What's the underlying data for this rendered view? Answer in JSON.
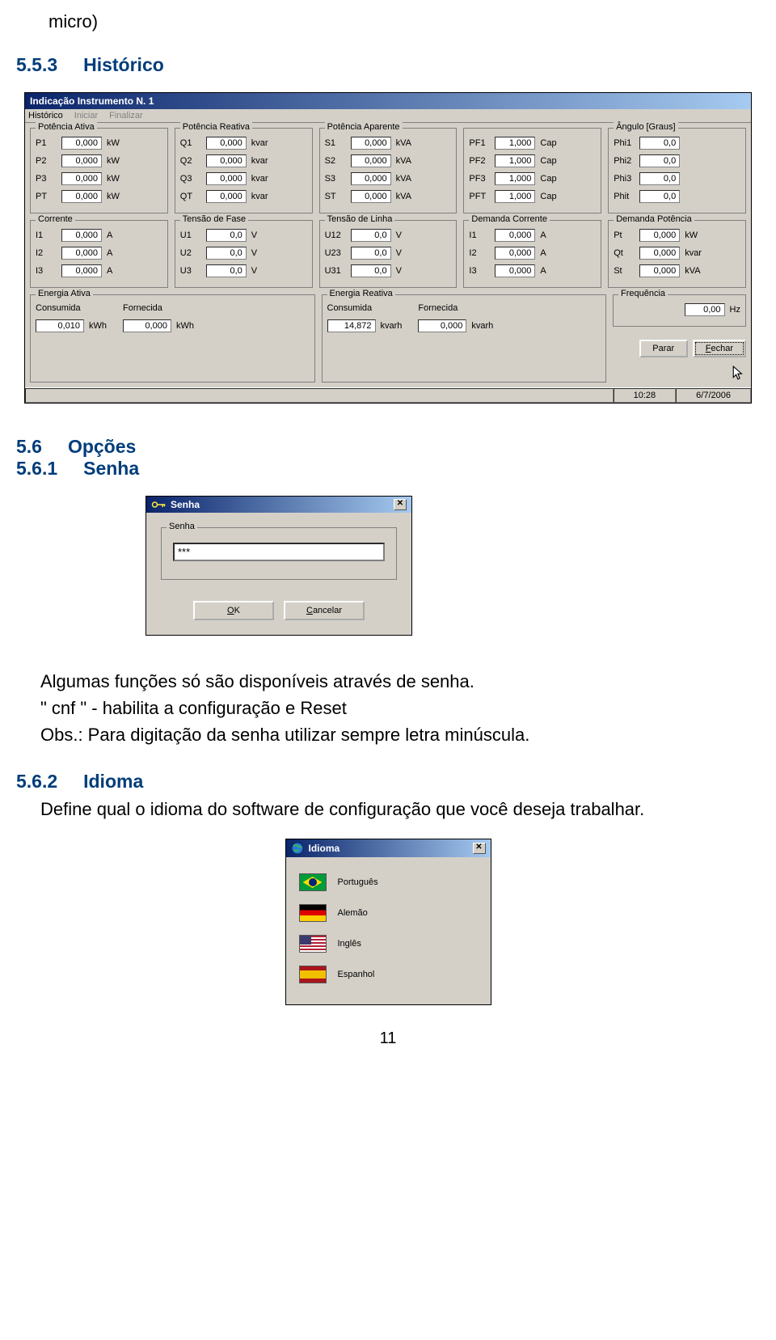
{
  "doc": {
    "micro_line": "micro)",
    "h1_num": "5.5.3",
    "h1_text": "Histórico",
    "h2_num": "5.6",
    "h2_text": "Opções",
    "h3_num": "5.6.1",
    "h3_text": "Senha",
    "para1": "Algumas funções só são disponíveis através de senha.",
    "para2": "\" cnf \" - habilita a configuração  e Reset",
    "para3": "Obs.: Para digitação da senha utilizar sempre letra minúscula.",
    "h4_num": "5.6.2",
    "h4_text": "Idioma",
    "para4": "Define qual o idioma do software de configuração que você deseja trabalhar.",
    "page_number": "11"
  },
  "win1": {
    "title": "Indicação Instrumento N. 1",
    "menu": {
      "historico": "Histórico",
      "iniciar": "Iniciar",
      "finalizar": "Finalizar"
    },
    "groups": {
      "potAtiva": {
        "title": "Potência Ativa",
        "rows": [
          {
            "lbl": "P1",
            "val": "0,000",
            "unit": "kW"
          },
          {
            "lbl": "P2",
            "val": "0,000",
            "unit": "kW"
          },
          {
            "lbl": "P3",
            "val": "0,000",
            "unit": "kW"
          },
          {
            "lbl": "PT",
            "val": "0,000",
            "unit": "kW"
          }
        ]
      },
      "potReativa": {
        "title": "Potência Reativa",
        "rows": [
          {
            "lbl": "Q1",
            "val": "0,000",
            "unit": "kvar"
          },
          {
            "lbl": "Q2",
            "val": "0,000",
            "unit": "kvar"
          },
          {
            "lbl": "Q3",
            "val": "0,000",
            "unit": "kvar"
          },
          {
            "lbl": "QT",
            "val": "0,000",
            "unit": "kvar"
          }
        ]
      },
      "potAparente": {
        "title": "Potência Aparente",
        "rows": [
          {
            "lbl": "S1",
            "val": "0,000",
            "unit": "kVA"
          },
          {
            "lbl": "S2",
            "val": "0,000",
            "unit": "kVA"
          },
          {
            "lbl": "S3",
            "val": "0,000",
            "unit": "kVA"
          },
          {
            "lbl": "ST",
            "val": "0,000",
            "unit": "kVA"
          }
        ]
      },
      "pf": {
        "title": "",
        "rows": [
          {
            "lbl": "PF1",
            "val": "1,000",
            "unit": "Cap"
          },
          {
            "lbl": "PF2",
            "val": "1,000",
            "unit": "Cap"
          },
          {
            "lbl": "PF3",
            "val": "1,000",
            "unit": "Cap"
          },
          {
            "lbl": "PFT",
            "val": "1,000",
            "unit": "Cap"
          }
        ]
      },
      "angulo": {
        "title": "Ângulo [Graus]",
        "rows": [
          {
            "lbl": "Phi1",
            "val": "0,0"
          },
          {
            "lbl": "Phi2",
            "val": "0,0"
          },
          {
            "lbl": "Phi3",
            "val": "0,0"
          },
          {
            "lbl": "Phit",
            "val": "0,0"
          }
        ]
      },
      "corrente": {
        "title": "Corrente",
        "rows": [
          {
            "lbl": "I1",
            "val": "0,000",
            "unit": "A"
          },
          {
            "lbl": "I2",
            "val": "0,000",
            "unit": "A"
          },
          {
            "lbl": "I3",
            "val": "0,000",
            "unit": "A"
          }
        ]
      },
      "tensaoFase": {
        "title": "Tensão de Fase",
        "rows": [
          {
            "lbl": "U1",
            "val": "0,0",
            "unit": "V"
          },
          {
            "lbl": "U2",
            "val": "0,0",
            "unit": "V"
          },
          {
            "lbl": "U3",
            "val": "0,0",
            "unit": "V"
          }
        ]
      },
      "tensaoLinha": {
        "title": "Tensão de Linha",
        "rows": [
          {
            "lbl": "U12",
            "val": "0,0",
            "unit": "V"
          },
          {
            "lbl": "U23",
            "val": "0,0",
            "unit": "V"
          },
          {
            "lbl": "U31",
            "val": "0,0",
            "unit": "V"
          }
        ]
      },
      "demCorrente": {
        "title": "Demanda Corrente",
        "rows": [
          {
            "lbl": "I1",
            "val": "0,000",
            "unit": "A"
          },
          {
            "lbl": "I2",
            "val": "0,000",
            "unit": "A"
          },
          {
            "lbl": "I3",
            "val": "0,000",
            "unit": "A"
          }
        ]
      },
      "demPotencia": {
        "title": "Demanda Potência",
        "rows": [
          {
            "lbl": "Pt",
            "val": "0,000",
            "unit": "kW"
          },
          {
            "lbl": "Qt",
            "val": "0,000",
            "unit": "kvar"
          },
          {
            "lbl": "St",
            "val": "0,000",
            "unit": "kVA"
          }
        ]
      },
      "energiaAtiva": {
        "title": "Energia Ativa",
        "cons_lbl": "Consumida",
        "cons_val": "0,010",
        "cons_unit": "kWh",
        "forn_lbl": "Fornecida",
        "forn_val": "0,000",
        "forn_unit": "kWh"
      },
      "energiaReativa": {
        "title": "Energia Reativa",
        "cons_lbl": "Consumida",
        "cons_val": "14,872",
        "cons_unit": "kvarh",
        "forn_lbl": "Fornecida",
        "forn_val": "0,000",
        "forn_unit": "kvarh"
      },
      "freq": {
        "title": "Frequência",
        "val": "0,00",
        "unit": "Hz"
      }
    },
    "btn_parar": "Parar",
    "btn_fechar_prefix": "F",
    "btn_fechar_rest": "echar",
    "status_time": "10:28",
    "status_date": "6/7/2006"
  },
  "win2": {
    "title": "Senha",
    "group_title": "Senha",
    "value": "***",
    "btn_ok_u": "O",
    "btn_ok_rest": "K",
    "btn_cancel_u": "C",
    "btn_cancel_rest": "ancelar"
  },
  "win3": {
    "title": "Idioma",
    "langs": [
      {
        "key": "pt",
        "label": "Português",
        "flagClass": "flag-br"
      },
      {
        "key": "de",
        "label": "Alemão",
        "flagClass": "flag-de"
      },
      {
        "key": "en",
        "label": "Inglês",
        "flagClass": "flag-us"
      },
      {
        "key": "es",
        "label": "Espanhol",
        "flagClass": "flag-es"
      }
    ]
  }
}
